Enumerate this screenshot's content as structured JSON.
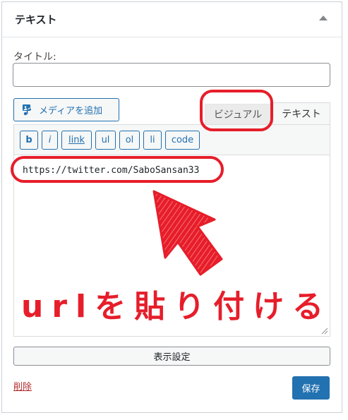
{
  "widget": {
    "title": "テキスト",
    "collapse_icon": "triangle-up-icon"
  },
  "form": {
    "title_label": "タイトル:",
    "title_value": ""
  },
  "editor": {
    "media_button_label": "メディアを追加",
    "media_icon": "media-icon",
    "tabs": {
      "visual": "ビジュアル",
      "text": "テキスト"
    },
    "quicktags": [
      "b",
      "i",
      "link",
      "ul",
      "ol",
      "li",
      "code"
    ],
    "content": "https://twitter.com/SaboSansan33"
  },
  "annotation": {
    "caption": "urlを貼り付ける",
    "arrow_icon": "red-arrow-icon",
    "color": "#e61e2a"
  },
  "footer": {
    "settings_label": "表示設定",
    "delete_label": "削除",
    "save_label": "保存"
  },
  "colors": {
    "primary": "#2271b1",
    "annotation_red": "#e61e2a",
    "delete_red": "#b32d2e"
  }
}
